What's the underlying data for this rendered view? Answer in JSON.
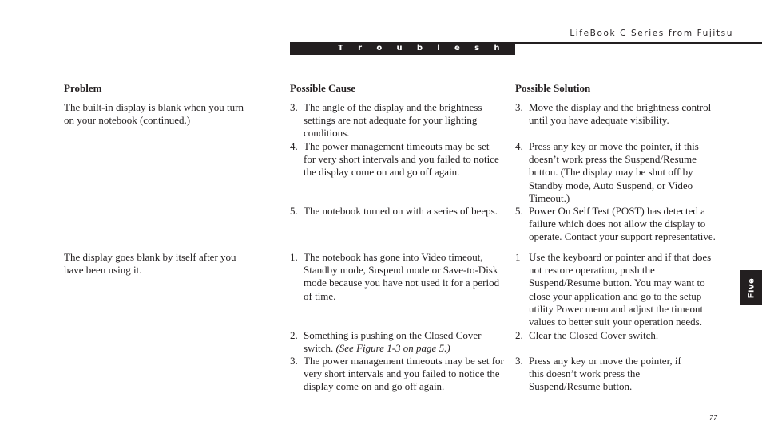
{
  "header": {
    "running_title": "LifeBook C Series from Fujitsu",
    "section_title": "T r o u b l e s h o o t i n g"
  },
  "columns": {
    "problem": "Problem",
    "cause": "Possible Cause",
    "solution": "Possible Solution"
  },
  "rows": [
    {
      "problem": "The built-in display is blank when you turn on your notebook (continued.)",
      "causes": [
        {
          "num": "3.",
          "text": "The angle of the display and the brightness settings are not adequate for your lighting conditions."
        },
        {
          "num": "4.",
          "text": "The power management timeouts may be set for very short intervals and you failed to notice the display come on and go off again."
        },
        {
          "num": "5.",
          "text": "The notebook turned on with a series of beeps."
        }
      ],
      "solutions": [
        {
          "num": "3.",
          "text": "Move the display and the brightness control until you have adequate visibility."
        },
        {
          "num": "4.",
          "text": "Press any key or move the pointer, if this doesn’t work press the Suspend/Resume button. (The display may be shut off by Standby mode, Auto Suspend, or Video Timeout.)"
        },
        {
          "num": "5.",
          "text": "Power On Self Test (POST) has detected a failure which does not allow the display to operate. Contact your support representative."
        }
      ]
    },
    {
      "problem": "The display goes blank by itself after you have been using it.",
      "causes": [
        {
          "num": "1.",
          "text": "The notebook has gone into Video timeout, Standby mode, Suspend mode or Save-to-Disk mode because you have not used it for a period of time."
        },
        {
          "num": "2.",
          "text": "Something is pushing on the Closed Cover switch.",
          "ref": "(See Figure 1-3 on page 5.)"
        },
        {
          "num": "3.",
          "text": "The power management timeouts may be set for very short intervals and you failed to notice the display come on and go off again."
        }
      ],
      "solutions": [
        {
          "num": "1",
          "text": "Use the keyboard or pointer and if that does not restore operation, push the Suspend/Resume button. You may want to close your application and go to the setup utility Power menu and adjust the timeout values to better suit your operation needs."
        },
        {
          "num": "2.",
          "text": "Clear the Closed Cover switch."
        },
        {
          "num": "3.",
          "text": "Press any key or move the pointer, if this doesn’t work press the Suspend/Resume button."
        }
      ]
    }
  ],
  "chapter_tab": "Five",
  "page_number": "77"
}
